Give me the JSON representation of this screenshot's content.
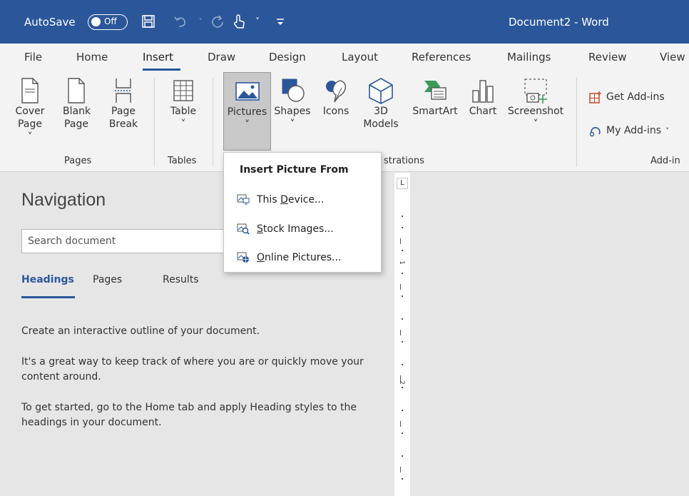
{
  "titlebar": {
    "autosave_label": "AutoSave",
    "toggle_state": "Off",
    "document_title": "Document2  -  Word",
    "bg_color": "#2b579a"
  },
  "tabs": [
    "File",
    "Home",
    "Insert",
    "Draw",
    "Design",
    "Layout",
    "References",
    "Mailings",
    "Review",
    "View"
  ],
  "active_tab": "Insert",
  "ribbon": {
    "pages": {
      "cover_page": [
        "Cover",
        "Page ˅"
      ],
      "blank_page": [
        "Blank",
        "Page"
      ],
      "page_break": [
        "Page",
        "Break"
      ],
      "label": "Pages"
    },
    "tables": {
      "table": "Table",
      "chev": "˅",
      "label": "Tables"
    },
    "illustrations": {
      "pictures": "Pictures",
      "shapes": "Shapes",
      "icons": "Icons",
      "models": [
        "3D",
        "Models"
      ],
      "smartart": "SmartArt",
      "chart": "Chart",
      "screenshot": "Screenshot",
      "chev": "˅",
      "label_visible": "strations"
    },
    "addins": {
      "get": "Get Add-ins",
      "my": "My Add-ins",
      "label_visible": "Add-in"
    }
  },
  "dropdown": {
    "header": "Insert Picture From",
    "items": [
      {
        "pre": "This ",
        "ul": "D",
        "post": "evice...",
        "icon": "device-icon"
      },
      {
        "pre": "",
        "ul": "S",
        "post": "tock Images...",
        "icon": "stock-images-icon"
      },
      {
        "pre": "",
        "ul": "O",
        "post": "nline Pictures...",
        "icon": "online-pictures-icon"
      }
    ]
  },
  "navigation": {
    "title": "Navigation",
    "search_placeholder": "Search document",
    "tabs": [
      "Headings",
      "Pages",
      "Results"
    ],
    "active_tab": "Headings",
    "paragraphs": [
      "Create an interactive outline of your document.",
      "It's a great way to keep track of where you are or quickly move your content around.",
      "To get started, go to the Home tab and apply Heading styles to the headings in your document."
    ]
  },
  "ruler": {
    "corner": "L",
    "numbers": [
      "1",
      "2"
    ]
  }
}
